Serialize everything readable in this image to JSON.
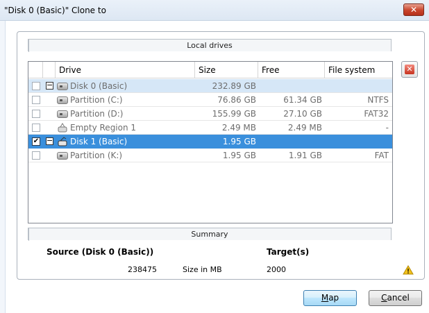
{
  "window": {
    "title": "\"Disk 0 (Basic)\" Clone to",
    "close_symbol": "✕"
  },
  "local_drives": {
    "header": "Local drives",
    "columns": [
      "Drive",
      "Size",
      "Free",
      "File system"
    ],
    "rows": [
      {
        "drive": "Disk 0 (Basic)",
        "size": "232.89 GB",
        "free": "",
        "fs": "",
        "checked": false,
        "type": "disk"
      },
      {
        "drive": "Partition (C:)",
        "size": "76.86 GB",
        "free": "61.34 GB",
        "fs": "NTFS",
        "checked": false,
        "type": "partition"
      },
      {
        "drive": "Partition (D:)",
        "size": "155.99 GB",
        "free": "27.10 GB",
        "fs": "FAT32",
        "checked": false,
        "type": "partition"
      },
      {
        "drive": "Empty Region 1",
        "size": "2.49 MB",
        "free": "2.49 MB",
        "fs": "-",
        "checked": false,
        "type": "empty-region"
      },
      {
        "drive": "Disk 1 (Basic)",
        "size": "1.95 GB",
        "free": "",
        "fs": "",
        "checked": true,
        "type": "disk"
      },
      {
        "drive": "Partition (K:)",
        "size": "1.95 GB",
        "free": "1.91 GB",
        "fs": "FAT",
        "checked": false,
        "type": "partition"
      }
    ],
    "selected_row": 4
  },
  "summary": {
    "header": "Summary",
    "source_label": "Source (Disk 0 (Basic))",
    "target_label": "Target(s)",
    "source_value": "238475",
    "unit_label": "Size in MB",
    "target_value": "2000"
  },
  "buttons": {
    "map_accel": "M",
    "map_rest": "ap",
    "cancel_accel": "C",
    "cancel_rest": "ancel"
  },
  "icons": {
    "delete": "delete-icon",
    "warning": "warning-icon",
    "disk": "disk-icon",
    "region": "region-icon"
  },
  "colors": {
    "selection": "#3a8fdc",
    "disk0_highlight": "#d6e7f7",
    "warning": "#f2c21b",
    "delete": "#c7331f"
  }
}
